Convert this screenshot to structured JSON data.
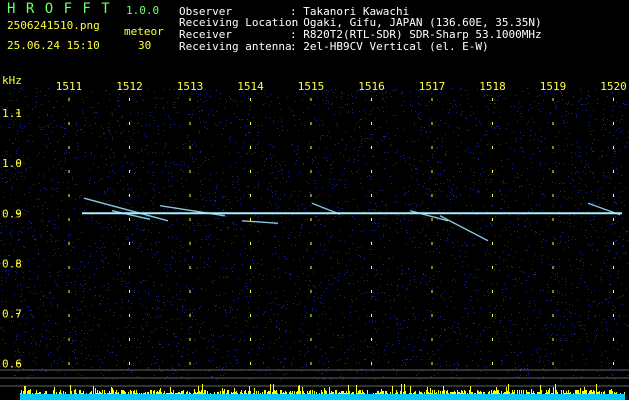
{
  "header": {
    "app_title": "H R O F F T",
    "app_version": "1.0.0",
    "file_name": "2506241510.png",
    "date_time": "25.06.24 15:10",
    "mode_label": "meteor",
    "count": "30",
    "info_labels": [
      "Observer",
      "Receiving Location",
      "Receiver",
      "Receiving antenna"
    ],
    "info_values": [
      ": Takanori Kawachi",
      ": Ogaki, Gifu, JAPAN (136.60E, 35.35N)",
      ": R820T2(RTL-SDR) SDR-Sharp 53.1000MHz",
      ": 2el-HB9CV Vertical (el. E-W)"
    ]
  },
  "chart_data": {
    "type": "heatmap",
    "title": "",
    "ylabel": "kHz",
    "x_ticks": [
      "1511",
      "1512",
      "1513",
      "1514",
      "1515",
      "1516",
      "1517",
      "1518",
      "1519",
      "1520"
    ],
    "y_ticks": [
      "1.1",
      "1.0",
      "0.9",
      "0.8",
      "0.7",
      "0.6"
    ],
    "carrier_khz": 0.9,
    "ylim": [
      0.6,
      1.15
    ],
    "grid": false,
    "colors": {
      "background": "#000000",
      "noise": "#1a2a8c",
      "signal": "#a8f0ff",
      "text": "#ffff3c",
      "level_bars": "#ffff00",
      "level_fill": "#00c8ff"
    }
  }
}
